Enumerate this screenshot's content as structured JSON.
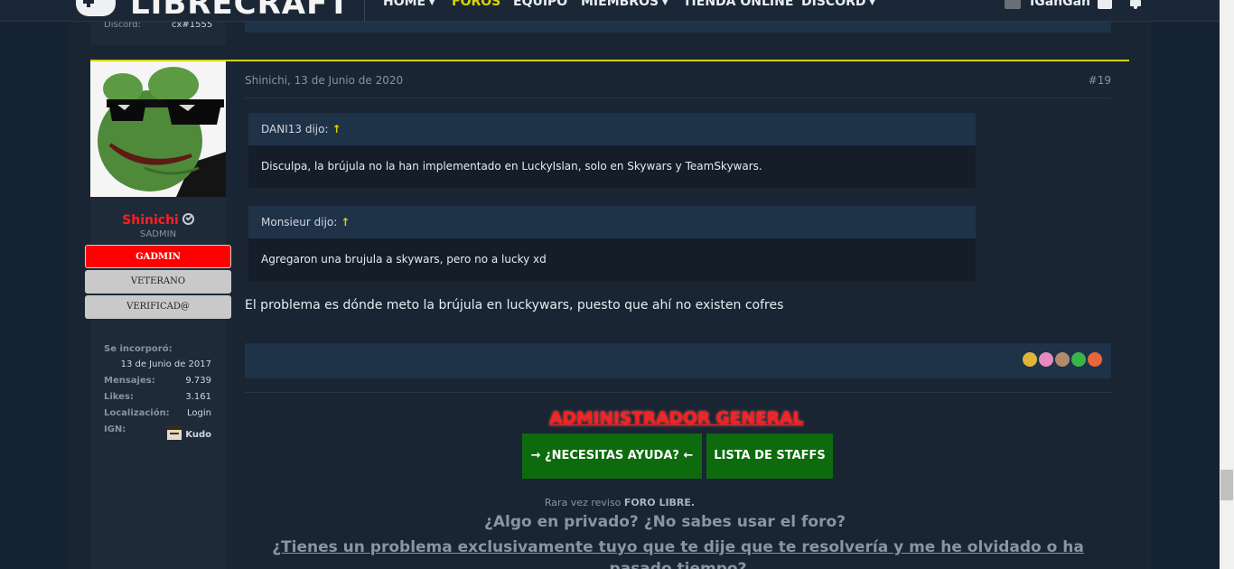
{
  "nav": {
    "logo": "LIBRECRAFT",
    "items": [
      {
        "label": "HOME",
        "caret": true,
        "active": false
      },
      {
        "label": "FOROS",
        "caret": false,
        "active": true
      },
      {
        "label": "EQUIPO",
        "caret": false,
        "active": false
      },
      {
        "label": "MIEMBROS",
        "caret": true,
        "active": false
      },
      {
        "label": "TIENDA ONLINE",
        "caret": false,
        "active": false
      },
      {
        "label": "DISCORD",
        "caret": true,
        "active": false
      }
    ],
    "username": "IGanGan"
  },
  "previous": {
    "discord_label": "Discord:",
    "discord_value": "cx#1555"
  },
  "post": {
    "author": "Shinichi",
    "user_title": "SADMIN",
    "banners": [
      "GADMIN",
      "VETERANO",
      "VERIFICAD@"
    ],
    "info": [
      {
        "label": "Se incorporó:",
        "value": "13 de Junio de 2017"
      },
      {
        "label": "Mensajes:",
        "value": "9.739"
      },
      {
        "label": "Likes:",
        "value": "3.161"
      },
      {
        "label": "Localización:",
        "value": "Login"
      },
      {
        "label": "IGN:",
        "value": "Kudo"
      }
    ],
    "date": "Shinichi, 13 de Junio de 2020",
    "number": "#19",
    "quotes": [
      {
        "head": "DANI13 dijo:",
        "arrow": "↑",
        "body": "Disculpa, la brújula no la han implementado en LuckyIslan, solo en Skywars y TeamSkywars."
      },
      {
        "head": "Monsieur dijo:",
        "arrow": "↑",
        "body": "Agregaron una brujula a skywars, pero no a lucky xd"
      }
    ],
    "text": "El problema es dónde meto la brújula en luckywars, puesto que ahí no existen cofres",
    "reaction_colors": [
      "#e0b43a",
      "#e68bbf",
      "#b08a6a",
      "#3bb54a",
      "#e8673a"
    ]
  },
  "signature": {
    "title": "ADMINISTRADOR GENERAL",
    "help_button": "→ ¿NECESITAS AYUDA? ←",
    "staff_button": "LISTA DE STAFFS",
    "small_prefix": "Rara vez reviso ",
    "small_bold": "FORO LIBRE.",
    "q1": "¿Algo en privado? ¿No sabes usar el foro?",
    "q2": "¿Tienes un problema exclusivamente tuyo que te dije que te resolvería y me he olvidado o ha pasado tiempo?"
  }
}
